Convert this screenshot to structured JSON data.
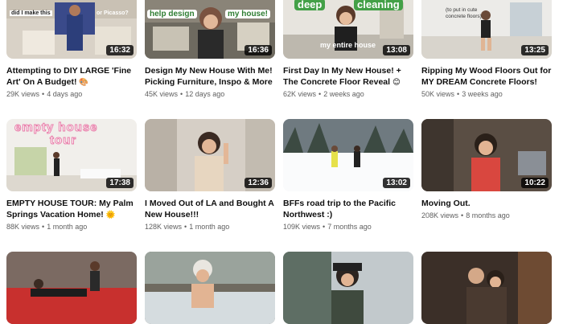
{
  "videos": [
    {
      "title": "Attempting to DIY LARGE 'Fine Art' On A Budget!",
      "title_emoji": "🎨",
      "views": "29K views",
      "age": "4 days ago",
      "duration": "16:32",
      "overlay": [
        "did I make this",
        "or Picasso?"
      ]
    },
    {
      "title": "Design My New House With Me! Picking Furniture, Inspo & More",
      "title_emoji": "🏡",
      "views": "45K views",
      "age": "12 days ago",
      "duration": "16:36",
      "overlay": [
        "help design",
        "my house!"
      ]
    },
    {
      "title": "First Day In My New House! + The Concrete Floor Reveal",
      "title_emoji": "😊",
      "views": "62K views",
      "age": "2 weeks ago",
      "duration": "13:08",
      "overlay": [
        "deep",
        "cleaning",
        "my entire house"
      ]
    },
    {
      "title": "Ripping My Wood Floors Out for MY DREAM Concrete Floors!",
      "title_emoji": "",
      "views": "50K views",
      "age": "3 weeks ago",
      "duration": "13:25",
      "overlay": [
        "(to put in cute",
        "concrete floors)"
      ]
    },
    {
      "title": "EMPTY HOUSE TOUR: My Palm Springs Vacation Home!",
      "title_emoji": "🌞",
      "views": "88K views",
      "age": "1 month ago",
      "duration": "17:38",
      "overlay": [
        "empty house",
        "tour"
      ]
    },
    {
      "title": "I Moved Out of LA and Bought A New House!!!",
      "title_emoji": "",
      "views": "128K views",
      "age": "1 month ago",
      "duration": "12:36",
      "overlay": []
    },
    {
      "title": "BFFs road trip to the Pacific Northwest :)",
      "title_emoji": "",
      "views": "109K views",
      "age": "7 months ago",
      "duration": "13:02",
      "overlay": []
    },
    {
      "title": "Moving Out.",
      "title_emoji": "",
      "views": "208K views",
      "age": "8 months ago",
      "duration": "10:22",
      "overlay": []
    },
    {
      "title": "",
      "title_emoji": "",
      "views": "",
      "age": "",
      "duration": "",
      "overlay": []
    },
    {
      "title": "",
      "title_emoji": "",
      "views": "",
      "age": "",
      "duration": "",
      "overlay": []
    },
    {
      "title": "",
      "title_emoji": "",
      "views": "",
      "age": "",
      "duration": "",
      "overlay": []
    },
    {
      "title": "",
      "title_emoji": "",
      "views": "",
      "age": "",
      "duration": "",
      "overlay": []
    }
  ],
  "colors": {
    "duration_bg": "#000000",
    "title": "#0f0f0f",
    "meta": "#606060",
    "accent_green": "#2e7d32",
    "accent_pink": "#f06292"
  }
}
